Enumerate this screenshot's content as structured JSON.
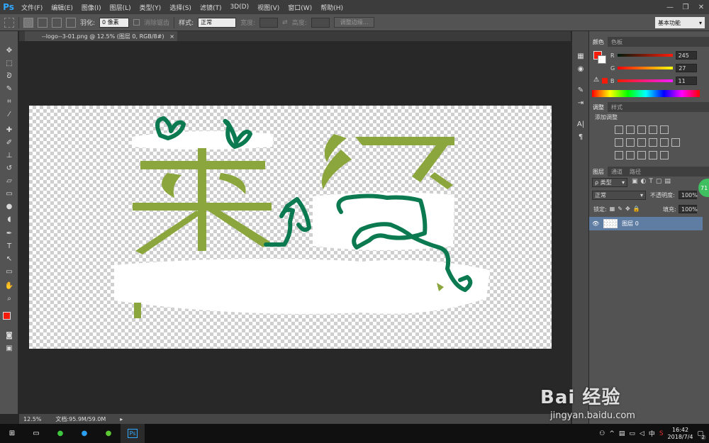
{
  "app": {
    "logo_text": "Ps"
  },
  "menus": [
    "文件(F)",
    "编辑(E)",
    "图像(I)",
    "图层(L)",
    "类型(Y)",
    "选择(S)",
    "滤镜(T)",
    "3D(D)",
    "视图(V)",
    "窗口(W)",
    "帮助(H)"
  ],
  "window_controls": {
    "minimize": "—",
    "restore": "❐",
    "close": "✕"
  },
  "options_bar": {
    "feather_label": "羽化:",
    "feather_value": "0 像素",
    "antialias_label": "消除锯齿",
    "style_label": "样式:",
    "style_value": "正常",
    "width_label": "宽度:",
    "height_label": "高度:",
    "refine_edge_button": "调整边缘...",
    "workspace": "基本功能"
  },
  "document": {
    "tab_title": "--logo--3-01.png @ 12.5% (图层 0, RGB/8#)",
    "close": "×"
  },
  "status_bar": {
    "zoom": "12.5%",
    "doc_size": "文档:95.9M/59.0M"
  },
  "color_panel": {
    "tabs": [
      "颜色",
      "色板"
    ],
    "foreground_color": "#f51b0b",
    "r_label": "R",
    "r_value": "245",
    "g_label": "G",
    "g_value": "27",
    "b_label": "B",
    "b_value": "11"
  },
  "adjustments_panel": {
    "tabs": [
      "调整",
      "样式"
    ],
    "title": "添加调整"
  },
  "layers_panel": {
    "tabs": [
      "图层",
      "通道",
      "路径"
    ],
    "filter_label": "ρ 类型",
    "blend_mode": "正常",
    "opacity_label": "不透明度:",
    "opacity_value": "100%",
    "lock_label": "锁定:",
    "fill_label": "填充:",
    "fill_value": "100%",
    "layer_name": "图层 0",
    "badge": "71"
  },
  "taskbar": {
    "time": "16:42",
    "date": "2018/7/4",
    "ime": "中",
    "notification_badge": "2"
  },
  "watermark": {
    "brand": "Bai 经验",
    "url": "jingyan.baidu.com"
  },
  "colors": {
    "logo_green": "#8aa63c",
    "stroke_green": "#0b7a50",
    "ps_blue": "#31a8ff"
  }
}
